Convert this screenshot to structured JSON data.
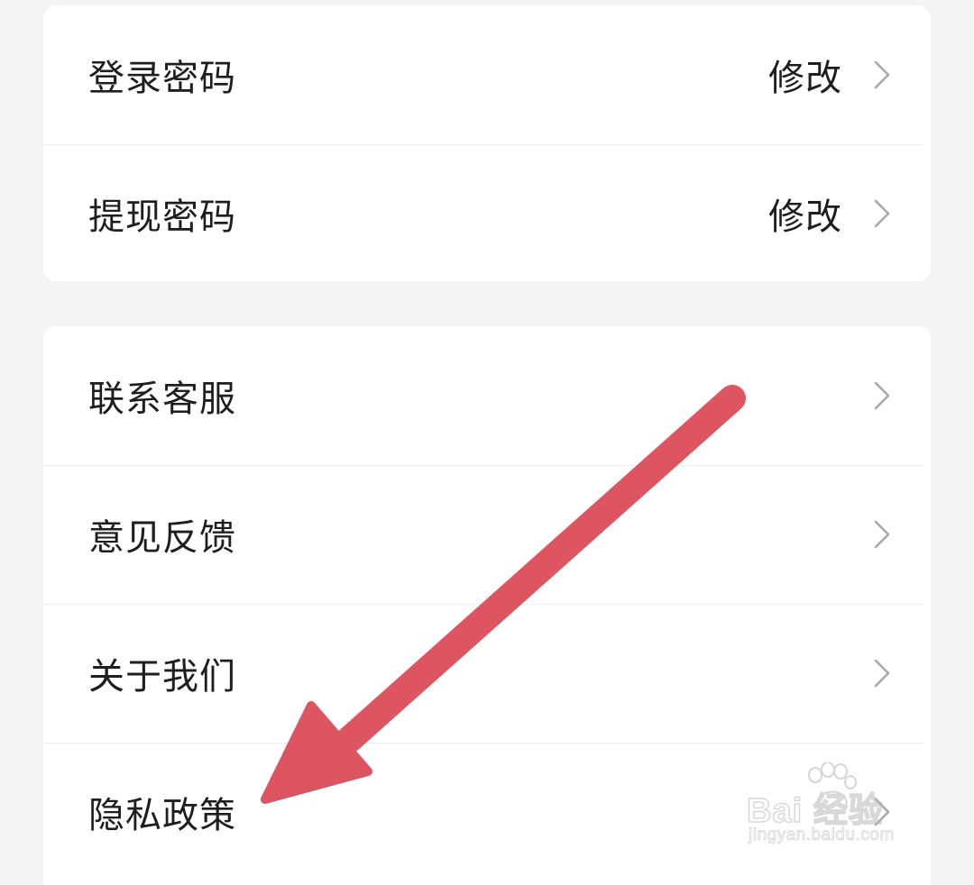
{
  "security_group": {
    "rows": [
      {
        "label": "登录密码",
        "value": "修改",
        "chevron": "chevron-right-icon"
      },
      {
        "label": "提现密码",
        "value": "修改",
        "chevron": "chevron-right-icon"
      }
    ]
  },
  "support_group": {
    "rows": [
      {
        "label": "联系客服",
        "chevron": "chevron-right-icon"
      },
      {
        "label": "意见反馈",
        "chevron": "chevron-right-icon"
      },
      {
        "label": "关于我们",
        "chevron": "chevron-right-icon"
      },
      {
        "label": "隐私政策",
        "chevron": "chevron-right-icon"
      }
    ]
  },
  "annotation": {
    "type": "arrow",
    "color": "#dc5560",
    "points_to": "隐私政策"
  },
  "watermark": {
    "brand": "Bai  经验",
    "url": "jingyan.baidu.com"
  },
  "colors": {
    "background": "#f4f4f4",
    "card": "#ffffff",
    "text": "#1e1e1e",
    "divider": "#efefef",
    "chevron": "#a8a8a8"
  }
}
